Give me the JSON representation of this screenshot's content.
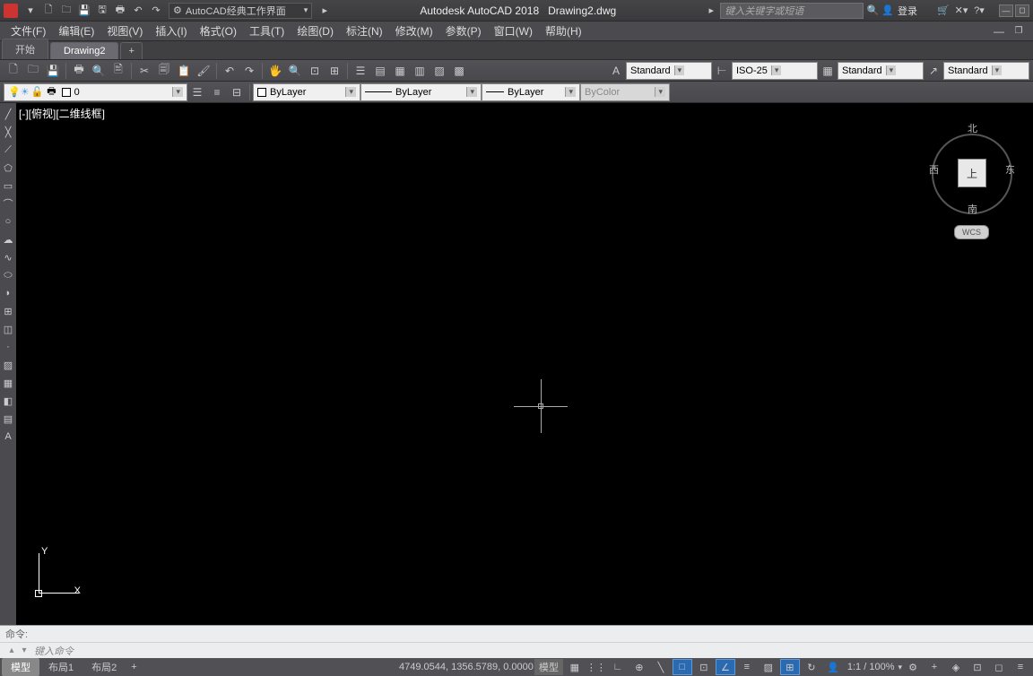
{
  "title": {
    "app": "Autodesk AutoCAD 2018",
    "file": "Drawing2.dwg"
  },
  "search": {
    "placeholder": "键入关键字或短语"
  },
  "sign_in": "登录",
  "workspace": {
    "label": "AutoCAD经典工作界面"
  },
  "menu": [
    "文件(F)",
    "编辑(E)",
    "视图(V)",
    "插入(I)",
    "格式(O)",
    "工具(T)",
    "绘图(D)",
    "标注(N)",
    "修改(M)",
    "参数(P)",
    "窗口(W)",
    "帮助(H)"
  ],
  "doc_tabs": {
    "start": "开始",
    "drawing": "Drawing2",
    "add": "+"
  },
  "layer": {
    "current": "0"
  },
  "props": {
    "layer": "ByLayer",
    "ltype": "ByLayer",
    "lweight": "ByLayer",
    "pcolor": "ByColor"
  },
  "styles": {
    "text": "Standard",
    "dim": "ISO-25",
    "table": "Standard",
    "mleader": "Standard"
  },
  "viewport": {
    "label": "[-][俯视][二维线框]"
  },
  "ucs": {
    "x": "X",
    "y": "Y"
  },
  "viewcube": {
    "n": "北",
    "s": "南",
    "e": "东",
    "w": "西",
    "top": "上",
    "wcs": "WCS"
  },
  "cmd": {
    "hist": "命令:",
    "prompt": "键入命令"
  },
  "layout_tabs": {
    "model": "模型",
    "layout1": "布局1",
    "layout2": "布局2",
    "add": "+"
  },
  "status": {
    "coords": "4749.0544, 1356.5789, 0.0000",
    "model": "模型",
    "scale": "1:1 / 100%"
  }
}
